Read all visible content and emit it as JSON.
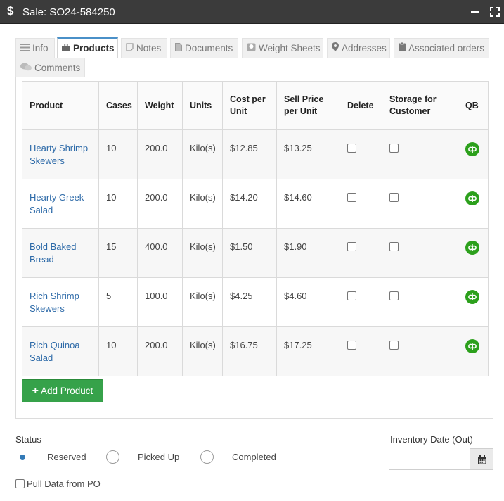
{
  "window": {
    "title": "Sale: SO24-584250",
    "icon": "dollar-icon"
  },
  "tabs": [
    {
      "label": "Info",
      "icon": "list-icon",
      "active": false
    },
    {
      "label": "Products",
      "icon": "briefcase-icon",
      "active": true
    },
    {
      "label": "Notes",
      "icon": "note-icon",
      "active": false
    },
    {
      "label": "Documents",
      "icon": "file-icon",
      "active": false
    },
    {
      "label": "Weight Sheets",
      "icon": "scale-icon",
      "active": false
    },
    {
      "label": "Addresses",
      "icon": "map-marker-icon",
      "active": false
    },
    {
      "label": "Associated orders",
      "icon": "clipboard-icon",
      "active": false
    },
    {
      "label": "Comments",
      "icon": "comments-icon",
      "active": false
    }
  ],
  "table": {
    "headers": [
      "Product",
      "Cases",
      "Weight",
      "Units",
      "Cost per Unit",
      "Sell Price per Unit",
      "Delete",
      "Storage for Customer",
      "QB"
    ],
    "rows": [
      {
        "product": "Hearty Shrimp Skewers",
        "cases": "10",
        "weight": "200.0",
        "units": "Kilo(s)",
        "cost": "$12.85",
        "sell": "$13.25",
        "delete": false,
        "storage": false
      },
      {
        "product": "Hearty Greek Salad",
        "cases": "10",
        "weight": "200.0",
        "units": "Kilo(s)",
        "cost": "$14.20",
        "sell": "$14.60",
        "delete": false,
        "storage": false
      },
      {
        "product": "Bold Baked Bread",
        "cases": "15",
        "weight": "400.0",
        "units": "Kilo(s)",
        "cost": "$1.50",
        "sell": "$1.90",
        "delete": false,
        "storage": false
      },
      {
        "product": "Rich Shrimp Skewers",
        "cases": "5",
        "weight": "100.0",
        "units": "Kilo(s)",
        "cost": "$4.25",
        "sell": "$4.60",
        "delete": false,
        "storage": false
      },
      {
        "product": "Rich Quinoa Salad",
        "cases": "10",
        "weight": "200.0",
        "units": "Kilo(s)",
        "cost": "$16.75",
        "sell": "$17.25",
        "delete": false,
        "storage": false
      }
    ]
  },
  "add_product_label": "Add Product",
  "status": {
    "label": "Status",
    "options": [
      {
        "label": "Reserved",
        "checked": true
      },
      {
        "label": "Picked Up",
        "checked": false
      },
      {
        "label": "Completed",
        "checked": false
      }
    ]
  },
  "inventory_date": {
    "label": "Inventory Date (Out)",
    "value": ""
  },
  "pull_data": {
    "label": "Pull Data from PO",
    "checked": false
  },
  "colors": {
    "titlebar": "#3b3b3b",
    "link": "#2d6aa8",
    "add_button": "#36a24a",
    "qb_icon": "#2ca01c",
    "radio_selected": "#337ab7"
  }
}
